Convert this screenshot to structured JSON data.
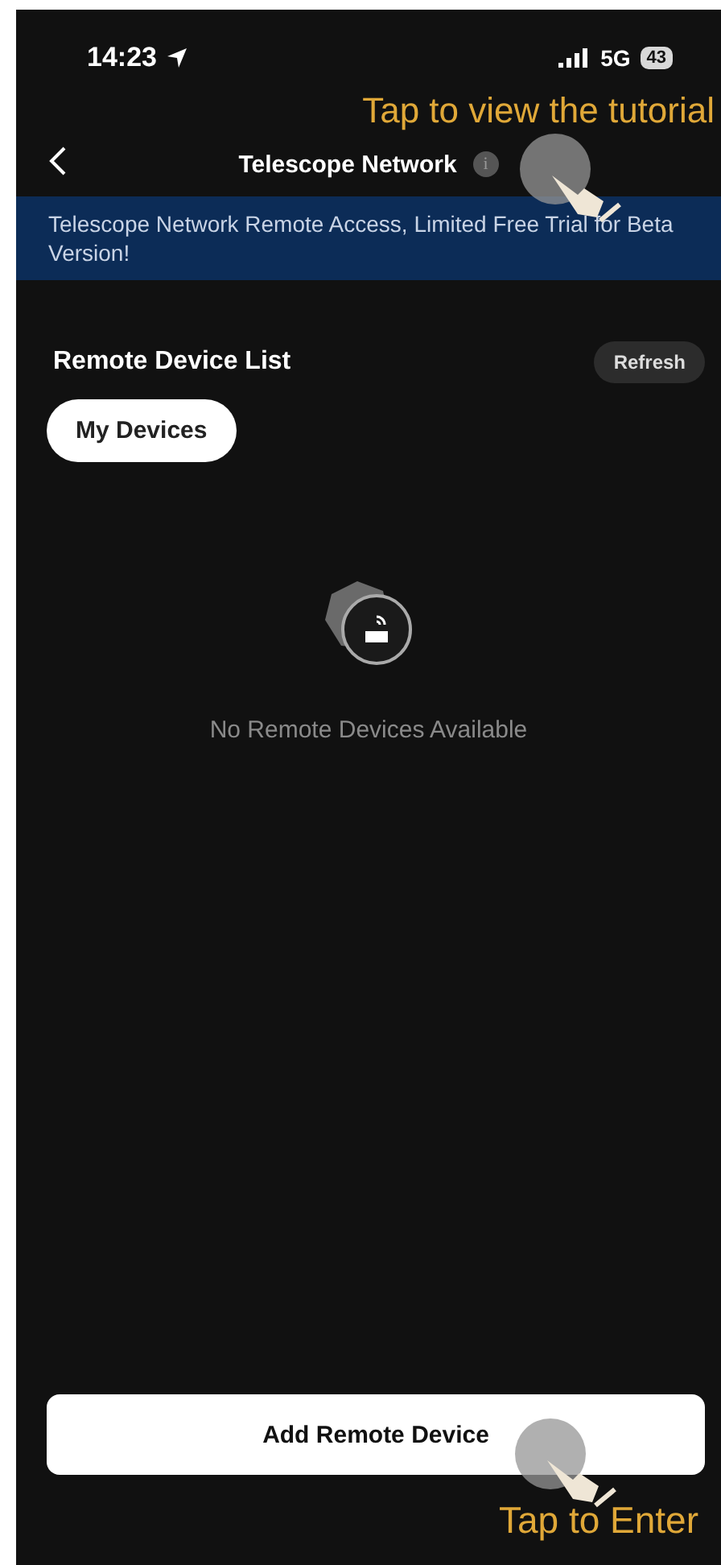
{
  "status_bar": {
    "time": "14:23",
    "network": "5G",
    "battery": "43"
  },
  "tutorial_hint": "Tap to  view the tutorial",
  "nav": {
    "title": "Telescope Network",
    "info": "i"
  },
  "banner": "Telescope Network Remote Access, Limited Free Trial for Beta Version!",
  "section": {
    "title": "Remote Device List",
    "action": "Refresh"
  },
  "filters": [
    {
      "label": "My Devices",
      "selected": true
    }
  ],
  "empty_state": "No Remote Devices Available",
  "primary_button": "Add Remote Device",
  "enter_hint": "Tap to Enter"
}
